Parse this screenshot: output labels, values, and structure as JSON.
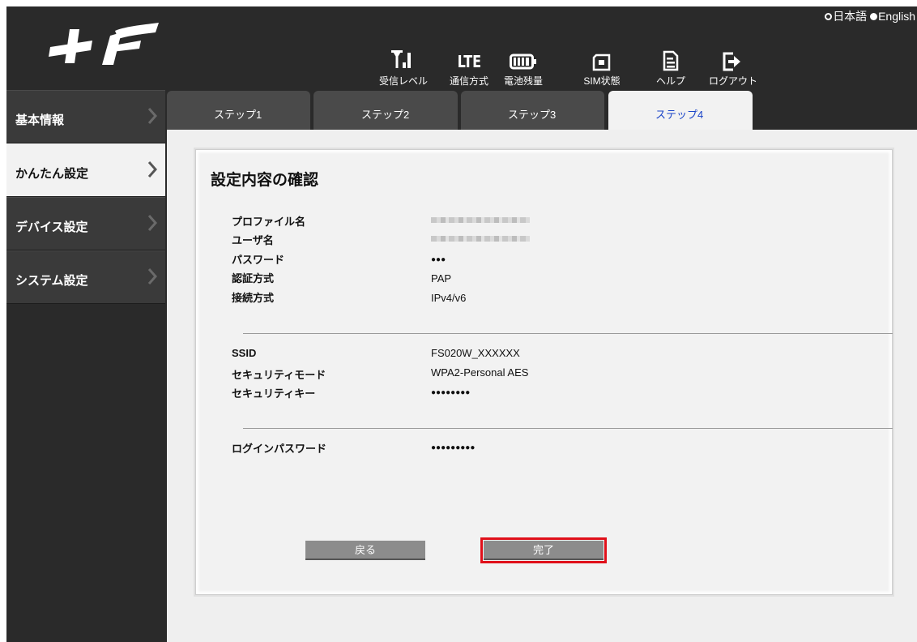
{
  "language": {
    "selected": "日本語",
    "other": "English"
  },
  "header": {
    "icons": [
      {
        "name": "signal-icon",
        "label": "受信レベル"
      },
      {
        "name": "lte-icon",
        "glyph": "LTE",
        "label": "通信方式"
      },
      {
        "name": "battery-icon",
        "label": "電池残量"
      },
      {
        "name": "sim-icon",
        "label": "SIM状態"
      },
      {
        "name": "help-icon",
        "label": "ヘルプ"
      },
      {
        "name": "logout-icon",
        "label": "ログアウト"
      }
    ]
  },
  "sidebar": {
    "items": [
      {
        "label": "基本情報",
        "active": false
      },
      {
        "label": "かんたん設定",
        "active": true
      },
      {
        "label": "デバイス設定",
        "active": false
      },
      {
        "label": "システム設定",
        "active": false
      }
    ]
  },
  "tabs": [
    {
      "label": "ステップ1",
      "active": false
    },
    {
      "label": "ステップ2",
      "active": false
    },
    {
      "label": "ステップ3",
      "active": false
    },
    {
      "label": "ステップ4",
      "active": true
    }
  ],
  "main": {
    "title": "設定内容の確認",
    "section1": [
      {
        "key": "プロファイル名",
        "value": ""
      },
      {
        "key": "ユーザ名",
        "value": ""
      },
      {
        "key": "パスワード",
        "value": "●●●"
      },
      {
        "key": "認証方式",
        "value": "PAP"
      },
      {
        "key": "接続方式",
        "value": "IPv4/v6"
      }
    ],
    "section2": [
      {
        "key": "SSID",
        "value": "FS020W_XXXXXX"
      },
      {
        "key": "セキュリティモード",
        "value": "WPA2-Personal AES"
      },
      {
        "key": "セキュリティキー",
        "value": "●●●●●●●●"
      }
    ],
    "section3": [
      {
        "key": "ログインパスワード",
        "value": "●●●●●●●●●"
      }
    ],
    "back_label": "戻る",
    "done_label": "完了"
  },
  "colors": {
    "active_tab_text": "#1a44c8",
    "highlight": "#e0101a",
    "sidebar_bg": "#3a3a3a"
  }
}
